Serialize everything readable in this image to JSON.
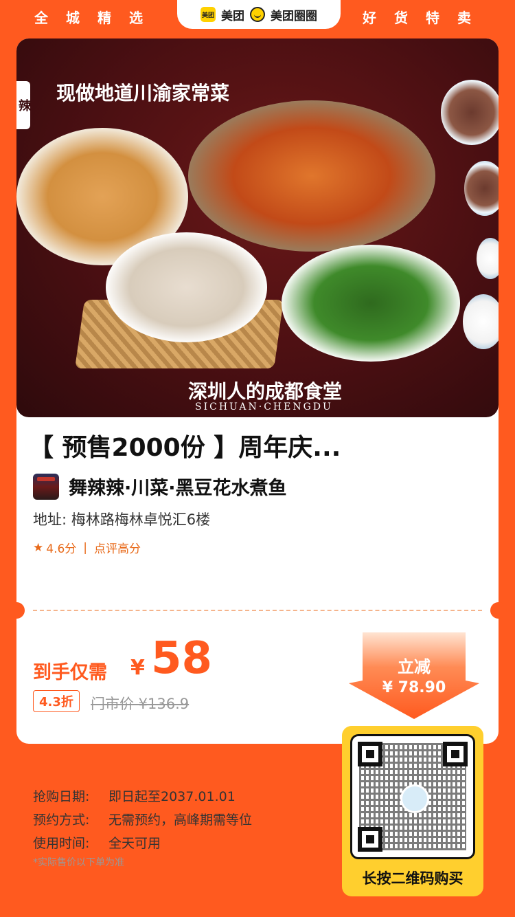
{
  "header": {
    "left_label": "全城精选",
    "right_label": "好货特卖",
    "brand_meituan_logo": "美团",
    "brand_meituan": "美团",
    "brand_quanquan": "美团圈圈"
  },
  "hero": {
    "headline": "现做地道川渝家常菜",
    "slogan": "深圳人的成都食堂",
    "slogan_en": "SICHUAN·CHENGDU",
    "badge": "辣"
  },
  "product": {
    "title": "【 预售2000份 】周年庆...",
    "shop_name": "舞辣辣·川菜·黑豆花水煮鱼",
    "address": "地址: 梅林路梅林卓悦汇6楼",
    "rating": "4.6分",
    "rating_tag": "点评高分"
  },
  "price": {
    "label": "到手仅需",
    "currency": "¥",
    "value": "58",
    "discount": "4.3折",
    "market_price": "门市价 ¥136.9"
  },
  "reduce": {
    "label": "立减",
    "amount": "¥ 78.90"
  },
  "info": {
    "purchase_date_key": "抢购日期:",
    "purchase_date_value": "即日起至2037.01.01",
    "booking_key": "预约方式:",
    "booking_value": "无需预约，高峰期需等位",
    "usage_key": "使用时间:",
    "usage_value": "全天可用",
    "footnote": "*实际售价以下单为准"
  },
  "qr": {
    "label": "长按二维码购买"
  },
  "colors": {
    "accent": "#FF5A1F",
    "qr_bg": "#FFCF2E"
  }
}
